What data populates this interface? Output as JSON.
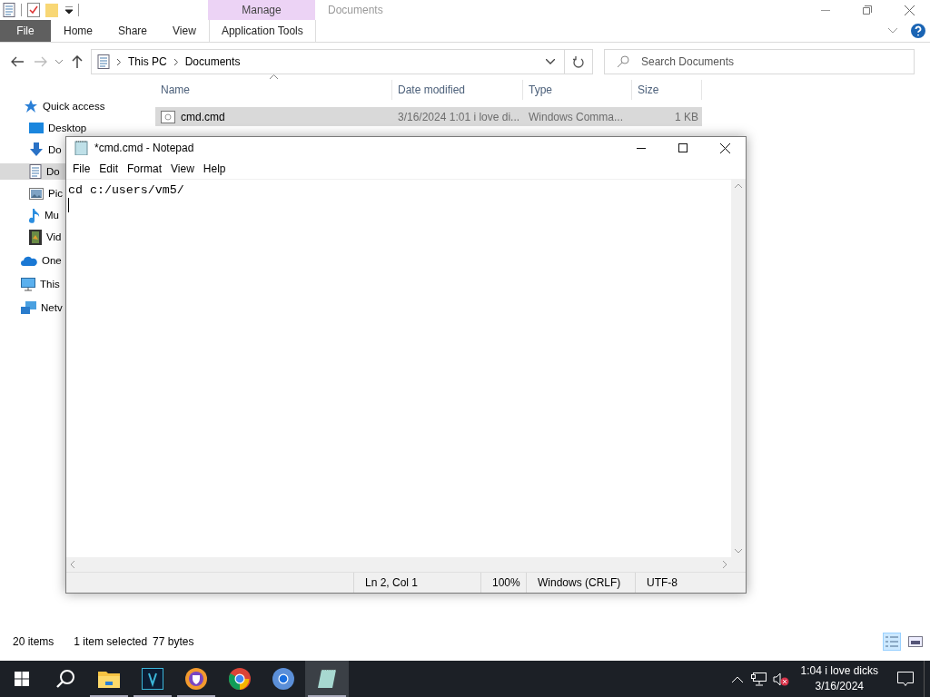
{
  "explorer": {
    "context_tab": "Manage",
    "title": "Documents",
    "ribbon_tabs": [
      {
        "label": "File",
        "kind": "file"
      },
      {
        "label": "Home",
        "kind": "plain"
      },
      {
        "label": "Share",
        "kind": "plain"
      },
      {
        "label": "View",
        "kind": "plain"
      },
      {
        "label": "Application Tools",
        "kind": "context"
      }
    ],
    "breadcrumb": [
      "This PC",
      "Documents"
    ],
    "search": {
      "placeholder": "Search Documents"
    },
    "columns": [
      "Name",
      "Date modified",
      "Type",
      "Size"
    ],
    "rows": [
      {
        "name": "cmd.cmd",
        "date": "3/16/2024 1:01 i love di...",
        "type": "Windows Comma...",
        "size": "1 KB",
        "selected": true
      }
    ],
    "sidebar": [
      {
        "label": "Quick access",
        "kind": "star",
        "selected": false,
        "children": [
          {
            "label": "Desktop",
            "kind": "desktop",
            "selected": false
          },
          {
            "label": "Do",
            "kind": "download",
            "selected": false
          },
          {
            "label": "Do",
            "kind": "document",
            "selected": true
          },
          {
            "label": "Pic",
            "kind": "picture",
            "selected": false
          },
          {
            "label": "Mu",
            "kind": "music",
            "selected": false
          },
          {
            "label": "Vid",
            "kind": "video",
            "selected": false
          }
        ]
      },
      {
        "label": "One",
        "kind": "cloud",
        "selected": false
      },
      {
        "label": "This",
        "kind": "pc",
        "selected": false
      },
      {
        "label": "Netv",
        "kind": "network",
        "selected": false
      }
    ],
    "status": {
      "count": "20 items",
      "selection": "1 item selected",
      "size": "77 bytes"
    }
  },
  "notepad": {
    "title": "*cmd.cmd - Notepad",
    "menu": [
      "File",
      "Edit",
      "Format",
      "View",
      "Help"
    ],
    "text": "cd c:/users/vm5/",
    "status": [
      "Ln 2, Col 1",
      "100%",
      "Windows (CRLF)",
      "UTF-8"
    ]
  },
  "taskbar": {
    "apps": [
      {
        "kind": "folder",
        "running": true,
        "active": false
      },
      {
        "kind": "v",
        "running": true,
        "active": false
      },
      {
        "kind": "shield",
        "running": true,
        "active": false
      },
      {
        "kind": "chrome",
        "running": false,
        "active": false
      },
      {
        "kind": "chromium",
        "running": false,
        "active": false
      },
      {
        "kind": "notepad",
        "running": true,
        "active": true
      }
    ],
    "clock": {
      "time": "1:04 i love dicks",
      "date": "3/16/2024"
    }
  }
}
